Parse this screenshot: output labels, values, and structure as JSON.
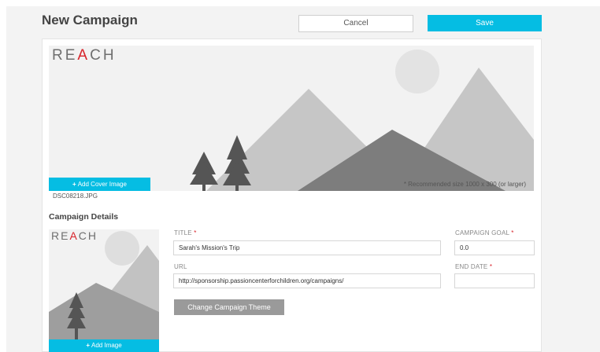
{
  "header": {
    "title": "New Campaign",
    "cancel_label": "Cancel",
    "save_label": "Save"
  },
  "cover": {
    "logo_prefix": "RE",
    "logo_accent": "A",
    "logo_suffix": "CH",
    "add_cover_label": "Add Cover Image",
    "recommended_note": "* Recommended size 1000 x 300 (or larger)",
    "filename": "DSC08218.JPG"
  },
  "details": {
    "section_title": "Campaign Details",
    "add_image_label": "Add Image",
    "title_label": "TITLE",
    "title_value": "Sarah's Mission's Trip",
    "url_label": "URL",
    "url_value": "http://sponsorship.passioncenterforchildren.org/campaigns/",
    "goal_label": "CAMPAIGN GOAL",
    "goal_value": "0.0",
    "end_date_label": "END DATE",
    "end_date_value": "",
    "required_mark": "*",
    "theme_button_label": "Change Campaign Theme"
  },
  "colors": {
    "accent": "#05bde3",
    "logo_red": "#d8232a",
    "theme_button": "#9a9a9a"
  }
}
